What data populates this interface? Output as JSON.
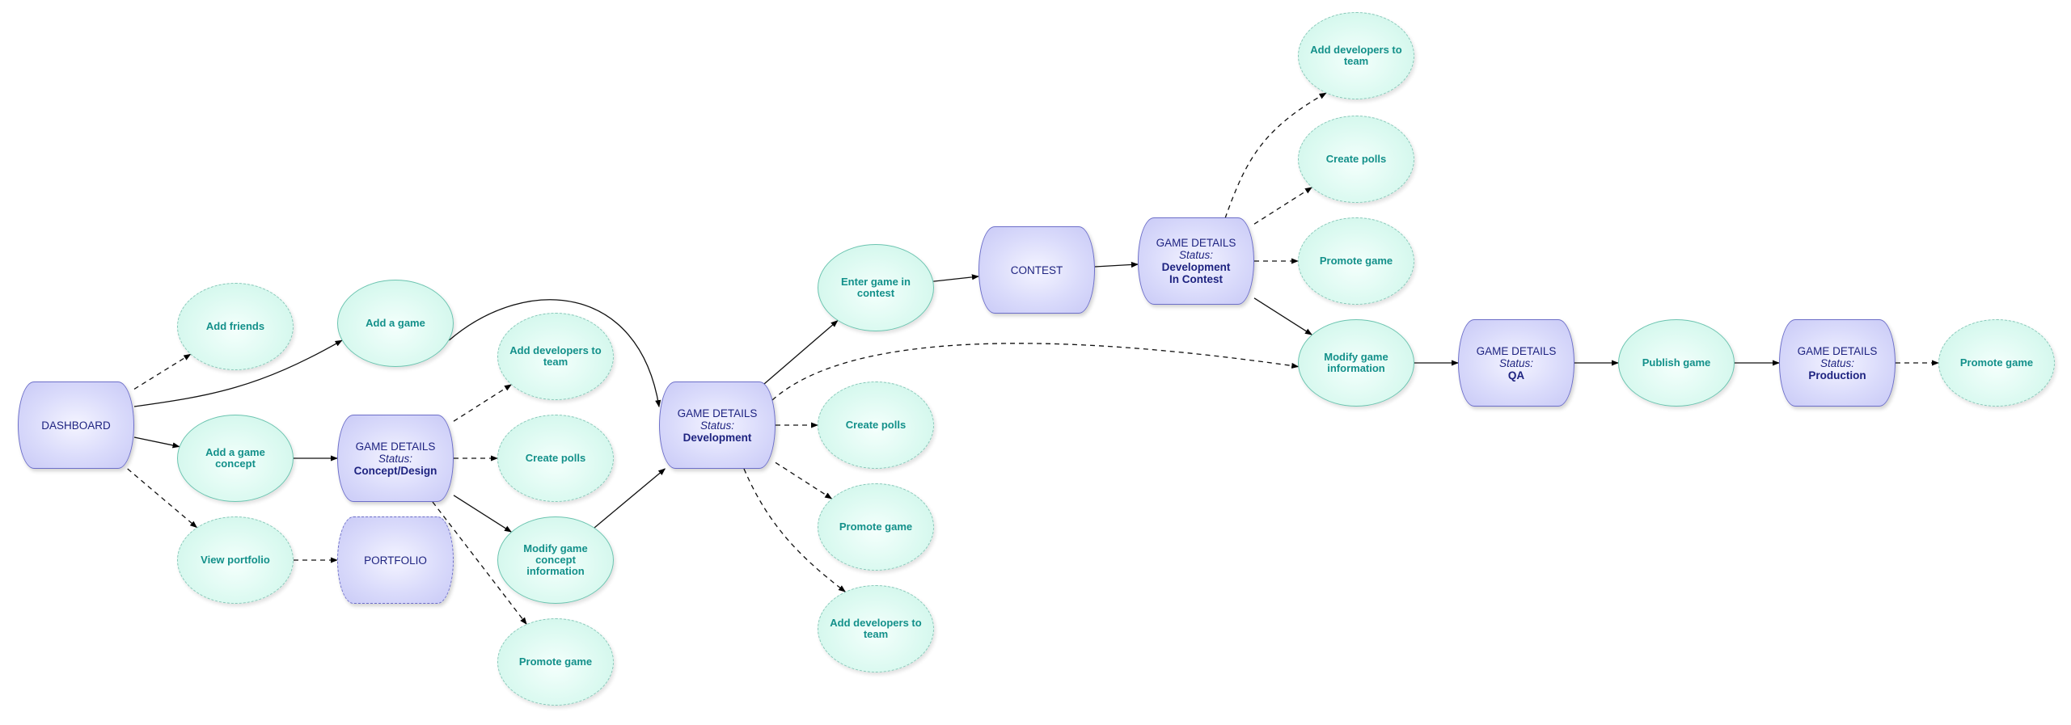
{
  "diagram": {
    "nodes": {
      "dashboard": {
        "label": "DASHBOARD"
      },
      "add_friends": {
        "label": "Add friends"
      },
      "add_game": {
        "label": "Add a game"
      },
      "add_concept": {
        "label": "Add a game concept"
      },
      "view_portfolio": {
        "label": "View portfolio"
      },
      "gd_concept": {
        "title": "GAME DETAILS",
        "status_label": "Status:",
        "status": "Concept/Design"
      },
      "portfolio": {
        "label": "PORTFOLIO"
      },
      "add_devs_1": {
        "label": "Add developers to team"
      },
      "create_polls_1": {
        "label": "Create polls"
      },
      "modify_concept": {
        "label": "Modify game concept information"
      },
      "promote_1": {
        "label": "Promote game"
      },
      "gd_dev": {
        "title": "GAME DETAILS",
        "status_label": "Status:",
        "status": "Development"
      },
      "enter_contest": {
        "label": "Enter game in contest"
      },
      "create_polls_2": {
        "label": "Create polls"
      },
      "promote_2": {
        "label": "Promote game"
      },
      "add_devs_2": {
        "label": "Add developers to team"
      },
      "contest": {
        "label": "CONTEST"
      },
      "gd_dev_contest": {
        "title": "GAME DETAILS",
        "status_label": "Status:",
        "status": "Development",
        "status2": "In Contest"
      },
      "add_devs_3": {
        "label": "Add developers to team"
      },
      "create_polls_3": {
        "label": "Create polls"
      },
      "promote_3": {
        "label": "Promote game"
      },
      "modify_info": {
        "label": "Modify game information"
      },
      "gd_qa": {
        "title": "GAME DETAILS",
        "status_label": "Status:",
        "status": "QA"
      },
      "publish": {
        "label": "Publish game"
      },
      "gd_prod": {
        "title": "GAME DETAILS",
        "status_label": "Status:",
        "status": "Production"
      },
      "promote_4": {
        "label": "Promote game"
      }
    },
    "edges": [
      {
        "from": "dashboard",
        "to": "add_friends",
        "style": "dashed"
      },
      {
        "from": "dashboard",
        "to": "add_game",
        "style": "solid"
      },
      {
        "from": "dashboard",
        "to": "add_concept",
        "style": "solid"
      },
      {
        "from": "dashboard",
        "to": "view_portfolio",
        "style": "dashed"
      },
      {
        "from": "add_concept",
        "to": "gd_concept",
        "style": "solid"
      },
      {
        "from": "view_portfolio",
        "to": "portfolio",
        "style": "dashed"
      },
      {
        "from": "add_game",
        "to": "gd_dev",
        "style": "solid"
      },
      {
        "from": "gd_concept",
        "to": "add_devs_1",
        "style": "dashed"
      },
      {
        "from": "gd_concept",
        "to": "create_polls_1",
        "style": "dashed"
      },
      {
        "from": "gd_concept",
        "to": "modify_concept",
        "style": "solid"
      },
      {
        "from": "gd_concept",
        "to": "promote_1",
        "style": "dashed"
      },
      {
        "from": "modify_concept",
        "to": "gd_dev",
        "style": "solid"
      },
      {
        "from": "gd_dev",
        "to": "enter_contest",
        "style": "solid"
      },
      {
        "from": "gd_dev",
        "to": "modify_info",
        "style": "dashed"
      },
      {
        "from": "gd_dev",
        "to": "create_polls_2",
        "style": "dashed"
      },
      {
        "from": "gd_dev",
        "to": "promote_2",
        "style": "dashed"
      },
      {
        "from": "gd_dev",
        "to": "add_devs_2",
        "style": "dashed"
      },
      {
        "from": "enter_contest",
        "to": "contest",
        "style": "solid"
      },
      {
        "from": "contest",
        "to": "gd_dev_contest",
        "style": "solid"
      },
      {
        "from": "gd_dev_contest",
        "to": "add_devs_3",
        "style": "dashed"
      },
      {
        "from": "gd_dev_contest",
        "to": "create_polls_3",
        "style": "dashed"
      },
      {
        "from": "gd_dev_contest",
        "to": "promote_3",
        "style": "dashed"
      },
      {
        "from": "gd_dev_contest",
        "to": "modify_info",
        "style": "solid"
      },
      {
        "from": "modify_info",
        "to": "gd_qa",
        "style": "solid"
      },
      {
        "from": "gd_qa",
        "to": "publish",
        "style": "solid"
      },
      {
        "from": "publish",
        "to": "gd_prod",
        "style": "solid"
      },
      {
        "from": "gd_prod",
        "to": "promote_4",
        "style": "dashed"
      }
    ]
  }
}
